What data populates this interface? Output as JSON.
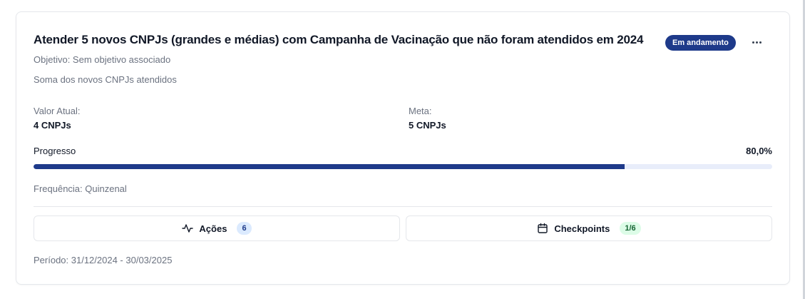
{
  "goal": {
    "title": "Atender 5 novos CNPJs (grandes e médias) com Campanha de Vacinação que não foram atendidos em 2024",
    "status": "Em andamento",
    "objective": "Objetivo: Sem objetivo associado",
    "metric": "Soma dos novos CNPJs atendidos",
    "current_label": "Valor Atual:",
    "current_value": "4 CNPJs",
    "target_label": "Meta:",
    "target_value": "5 CNPJs",
    "progress_label": "Progresso",
    "progress_text": "80,0%",
    "progress_fraction": 0.8,
    "frequency": "Frequência: Quinzenal",
    "period": "Período: 31/12/2024 - 30/03/2025"
  },
  "buttons": {
    "actions": {
      "label": "Ações",
      "count": "6",
      "icon": "activity-icon"
    },
    "checkpoints": {
      "label": "Checkpoints",
      "count": "1/6",
      "icon": "calendar-icon"
    }
  },
  "colors": {
    "accent": "#1e3a8a",
    "track": "#e8edfa",
    "actions_badge_bg": "#dbeafe",
    "checkpoints_badge_bg": "#dcfce7"
  }
}
